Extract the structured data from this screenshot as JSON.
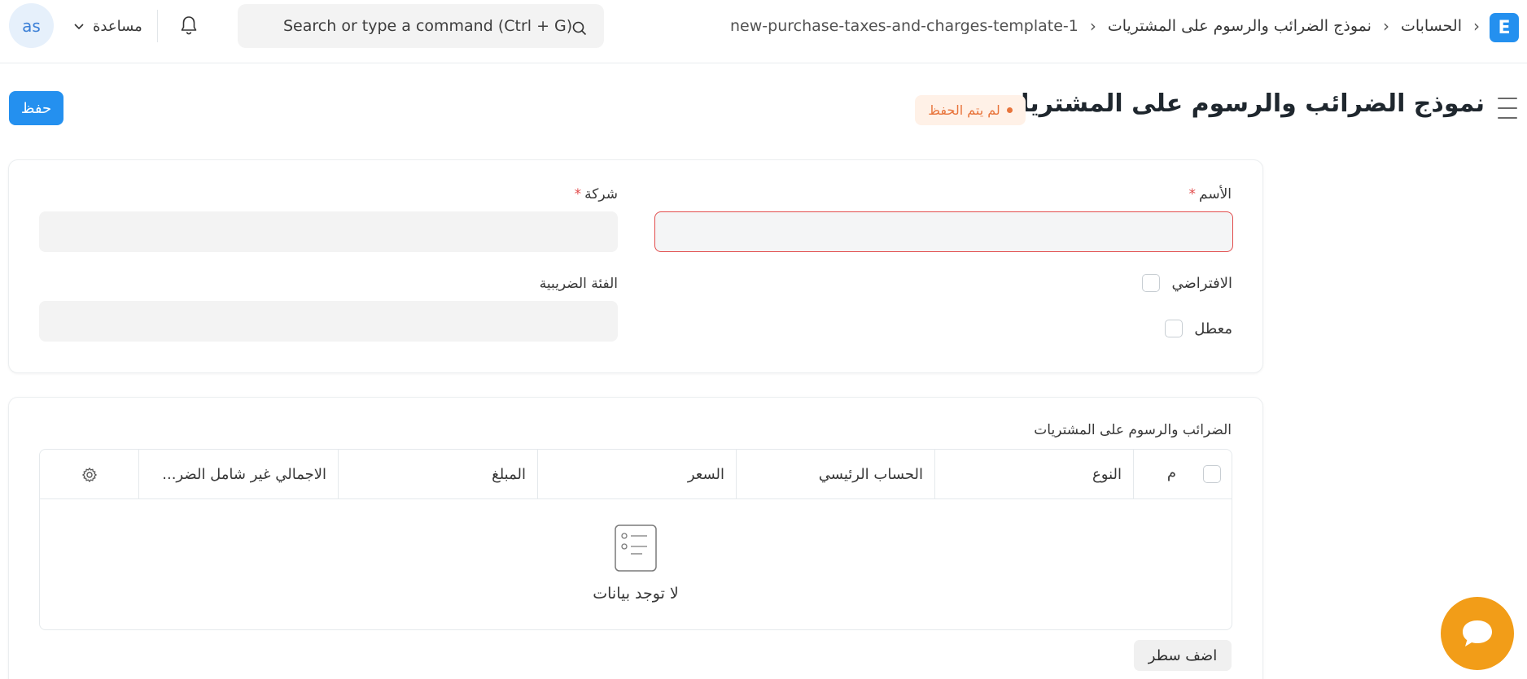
{
  "navbar": {
    "avatar_initials": "as",
    "help_label": "مساعدة",
    "search_placeholder": "Search or type a command (Ctrl + G)",
    "breadcrumb": [
      "الحسابات",
      "نموذج الضرائب والرسوم على المشتريات",
      "new-purchase-taxes-and-charges-template-1"
    ],
    "app_logo_letter": "E"
  },
  "page": {
    "title": "نموذج الضرائب والرسوم على المشتريات جديد",
    "status": "لم يتم الحفظ",
    "save_label": "حفظ"
  },
  "form": {
    "name_label": "الأسم",
    "company_label": "شركة",
    "default_label": "الافتراضي",
    "disabled_label": "معطل",
    "tax_category_label": "الفئة الضريبية",
    "required_mark": "*"
  },
  "taxes_table": {
    "section_label": "الضرائب والرسوم على المشتريات",
    "columns": [
      "م",
      "النوع",
      "الحساب الرئيسي",
      "السعر",
      "المبلغ",
      "الاجمالي غير شامل الضر..."
    ],
    "empty_text": "لا توجد بيانات",
    "add_row_label": "اضف سطر"
  },
  "colors": {
    "primary": "#2490ef",
    "error_border": "#e24c4c",
    "status_orange": "#e8743b",
    "chat_orange": "#f29d18"
  }
}
